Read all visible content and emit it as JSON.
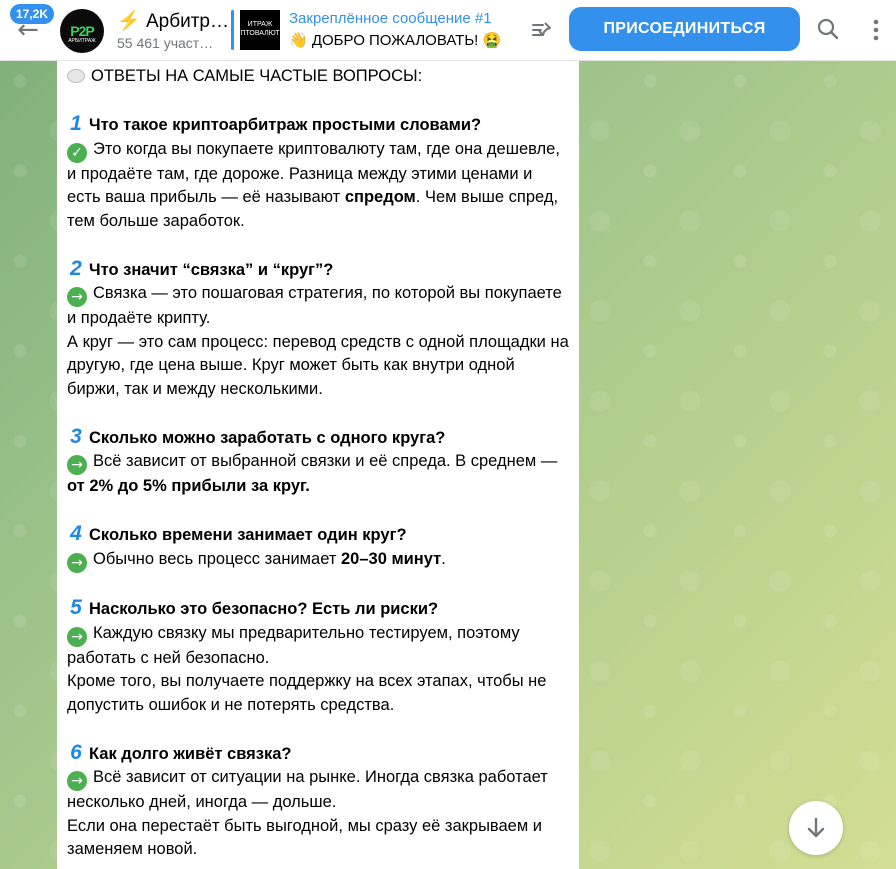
{
  "header": {
    "back_icon": "arrow-left-icon",
    "unread_count": "17,2K",
    "avatar_logo": "P2P",
    "avatar_caption": "АРБИТРАЖ",
    "title_emoji": "⚡",
    "title": "Арбитр…",
    "subscribers": "55 461 участ…",
    "pinned": {
      "thumb_text": "ИТРАЖ ПТОВАЛЮТ",
      "title": "Закреплённое сообщение #1",
      "text": "👋 ДОБРО ПОЖАЛОВАТЬ! 🤮"
    },
    "join_label": "ПРИСОЕДИНИТЬСЯ",
    "accent": "#3390ec"
  },
  "message": {
    "intro": "ОТВЕТЫ НА САМЫЕ ЧАСТЫЕ ВОПРОСЫ:",
    "faq": [
      {
        "num": "1",
        "question": "Что такое криптоарбитраж простыми словами?",
        "icon": "check",
        "answer_html": "Это когда вы покупаете криптовалюту там, где она дешевле, и продаёте там, где дороже. Разница между этими ценами и есть ваша прибыль — её называют <b>спредом</b>. Чем выше спред, тем больше заработок."
      },
      {
        "num": "2",
        "question": "Что значит “связка” и “круг”?",
        "icon": "arrow",
        "answer_html": "Связка — это пошаговая стратегия, по которой вы покупаете и продаёте крипту.<br>А круг — это сам процесс: перевод средств с одной площадки на другую, где цена выше. Круг может быть как внутри одной биржи, так и между несколькими."
      },
      {
        "num": "3",
        "question": "Сколько можно заработать с одного круга?",
        "icon": "arrow",
        "answer_html": "Всё зависит от выбранной связки и её спреда. В среднем — <b>от 2% до 5% прибыли за круг.</b>"
      },
      {
        "num": "4",
        "question": "Сколько времени занимает один круг?",
        "icon": "arrow",
        "answer_html": "Обычно весь процесс занимает <b>20–30 минут</b>."
      },
      {
        "num": "5",
        "question": "Насколько это безопасно? Есть ли риски?",
        "icon": "arrow",
        "answer_html": "Каждую связку мы предварительно тестируем, поэтому работать с ней безопасно.<br>Кроме того, вы получаете поддержку на всех этапах, чтобы не допустить ошибок и не потерять средства."
      },
      {
        "num": "6",
        "question": "Как долго живёт связка?",
        "icon": "arrow",
        "answer_html": "Всё зависит от ситуации на рынке. Иногда связка работает несколько дней, иногда — дольше.<br>Если она перестаёт быть выгодной, мы сразу её закрываем и заменяем новой."
      }
    ]
  },
  "scroll_down_icon": "chevron-down-icon"
}
